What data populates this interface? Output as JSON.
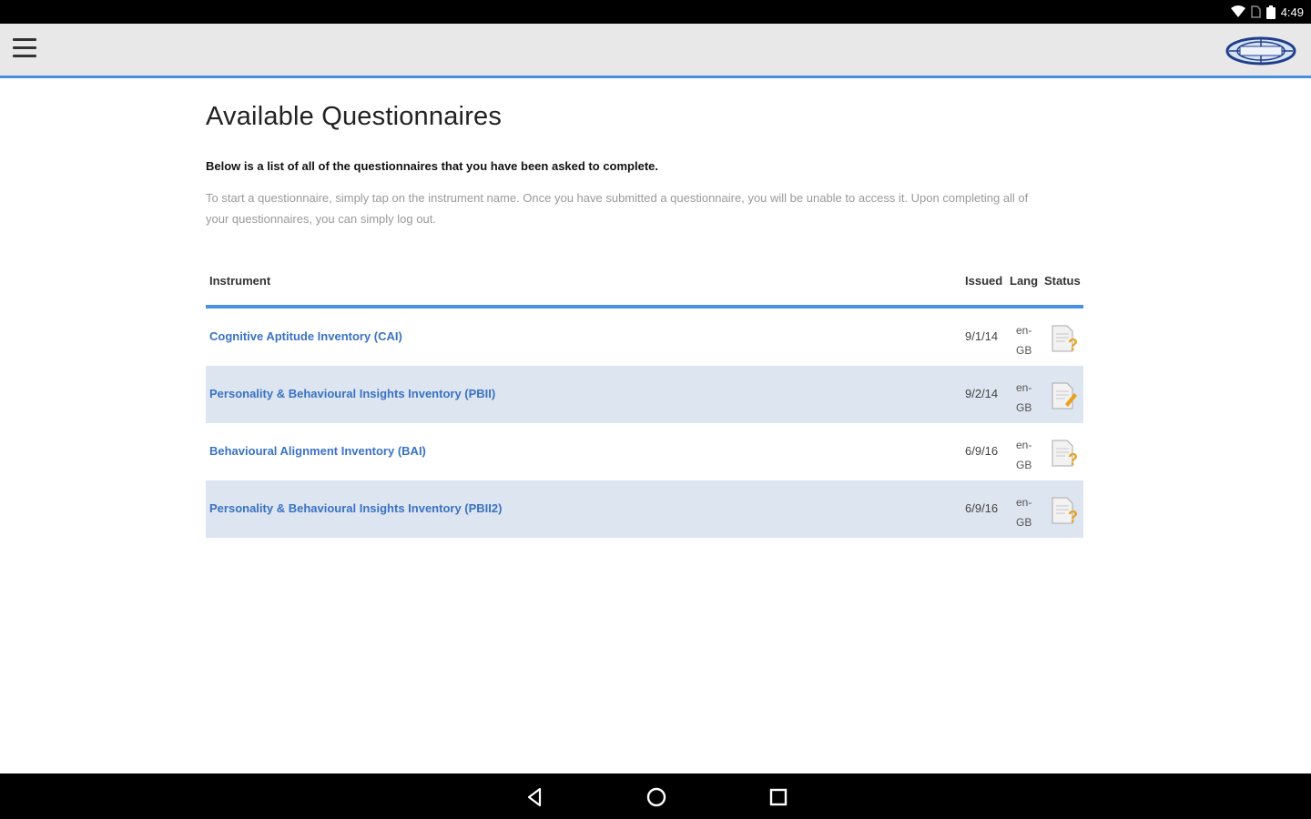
{
  "status_bar": {
    "time": "4:49",
    "icons": [
      "wifi-icon",
      "sim-icon",
      "battery-icon"
    ]
  },
  "app_bar": {
    "menu_icon": "hamburger-menu-icon",
    "logo_icon": "brand-logo-icon"
  },
  "page": {
    "title": "Available Questionnaires",
    "intro_bold": "Below is a list of all of the questionnaires that you have been asked to complete.",
    "intro_light": "To start a questionnaire, simply tap on the instrument name. Once you have submitted a questionnaire, you will be unable to access it. Upon completing all of your questionnaires, you can simply log out."
  },
  "table": {
    "headers": {
      "instrument": "Instrument",
      "issued": "Issued",
      "lang": "Lang",
      "status": "Status"
    },
    "rows": [
      {
        "instrument": "Cognitive Aptitude Inventory (CAI)",
        "issued": "9/1/14",
        "lang_top": "en-",
        "lang_bottom": "GB",
        "status_icon": "document-question-icon"
      },
      {
        "instrument": "Personality & Behavioural Insights Inventory (PBII)",
        "issued": "9/2/14",
        "lang_top": "en-",
        "lang_bottom": "GB",
        "status_icon": "document-edit-icon"
      },
      {
        "instrument": "Behavioural Alignment Inventory (BAI)",
        "issued": "6/9/16",
        "lang_top": "en-",
        "lang_bottom": "GB",
        "status_icon": "document-question-icon"
      },
      {
        "instrument": "Personality & Behavioural Insights Inventory (PBII2)",
        "issued": "6/9/16",
        "lang_top": "en-",
        "lang_bottom": "GB",
        "status_icon": "document-question-icon"
      }
    ]
  },
  "nav_bar": {
    "icons": [
      "back-icon",
      "home-icon",
      "recents-icon"
    ]
  },
  "colors": {
    "accent": "#4a90e2",
    "link": "#3a72c4",
    "alt_row": "#dde5f0",
    "app_bar": "#e8e8e8"
  }
}
